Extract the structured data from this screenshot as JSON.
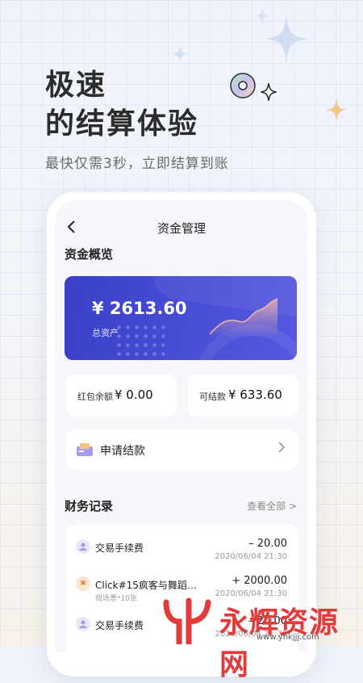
{
  "promo": {
    "headline_line1": "极速",
    "headline_line2": "的结算体验",
    "subline": "最快仅需3秒，立即结算到账"
  },
  "app": {
    "back_icon": "chevron-left-icon",
    "title": "资金管理",
    "overview_title": "资金概览",
    "asset_card": {
      "amount": "¥ 2613.60",
      "label": "总资产"
    },
    "balances": [
      {
        "label": "红包余额",
        "value": "¥ 0.00"
      },
      {
        "label": "可结款",
        "value": "¥ 633.60"
      }
    ],
    "apply": {
      "label": "申请结款",
      "icon": "settlement-icon"
    },
    "records_title": "财务记录",
    "view_all": "查看全部 >",
    "records": [
      {
        "name": "交易手续费",
        "sub": "",
        "amount": "– 20.00",
        "time": "2020/06/04  21:30",
        "icon": "fee-icon",
        "color": "#a89be6"
      },
      {
        "name": "Click#15疯客与舞蹈…",
        "sub": "现场票*10张",
        "amount": "+ 2000.00",
        "time": "2020/06/04  21:30",
        "icon": "ticket-icon",
        "color": "#f3a25e"
      },
      {
        "name": "交易手续费",
        "sub": "",
        "amount": "– 20.00",
        "time": "2020/06/04  21:30",
        "icon": "fee-icon",
        "color": "#a89be6"
      }
    ]
  },
  "watermark": {
    "text": "永辉资源网",
    "url": "www.yhkjjj.com"
  },
  "colors": {
    "card_blue": "#4a4fd8",
    "watermark_red": "#e33a3a"
  }
}
